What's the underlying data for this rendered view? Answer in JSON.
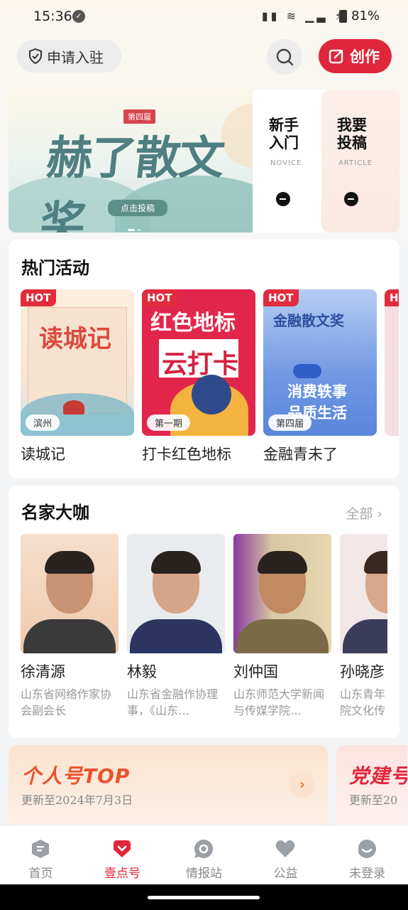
{
  "status": {
    "time": "15:36",
    "battery": "81%"
  },
  "header": {
    "apply_label": "申请入驻",
    "create_label": "创作"
  },
  "banner": {
    "tag": "第四届",
    "title": "赫了散文奖",
    "cta": "点击投稿",
    "quick": [
      {
        "title": "新手入门",
        "en": "NOVICE"
      },
      {
        "title": "我要投稿",
        "en": "ARTICLE"
      }
    ]
  },
  "hot_activities": {
    "title": "热门活动",
    "items": [
      {
        "hot": "HOT",
        "badge": "滨州",
        "name": "读城记",
        "art": "读城记"
      },
      {
        "hot": "HOT",
        "badge": "第一期",
        "name": "打卡红色地标",
        "art1": "红色地标",
        "art2": "云打卡"
      },
      {
        "hot": "HOT",
        "badge": "第四届",
        "name": "金融青未了",
        "art1": "金融散文奖",
        "art2": "消费轶事",
        "art3": "品质生活"
      }
    ]
  },
  "masters": {
    "title": "名家大咖",
    "more": "全部",
    "people": [
      {
        "name": "徐清源",
        "desc": "山东省网络作家协会副会长"
      },
      {
        "name": "林毅",
        "desc": "山东省金融作协理事，《山东…"
      },
      {
        "name": "刘仲国",
        "desc": "山东师范大学新闻与传媒学院…"
      },
      {
        "name": "孙晓彦",
        "desc": "山东青年院文化传"
      }
    ]
  },
  "top_cards": [
    {
      "title": "个人号TOP",
      "sub": "更新至2024年7月3日"
    },
    {
      "title": "党建号",
      "sub": "更新至20"
    }
  ],
  "tabbar": [
    {
      "label": "首页",
      "icon": "home-icon"
    },
    {
      "label": "壹点号",
      "icon": "heart-icon",
      "active": true
    },
    {
      "label": "情报站",
      "icon": "radar-icon"
    },
    {
      "label": "公益",
      "icon": "love-icon"
    },
    {
      "label": "未登录",
      "icon": "user-icon"
    }
  ],
  "colors": {
    "brand": "#e0263a",
    "accent": "#e8532f"
  }
}
